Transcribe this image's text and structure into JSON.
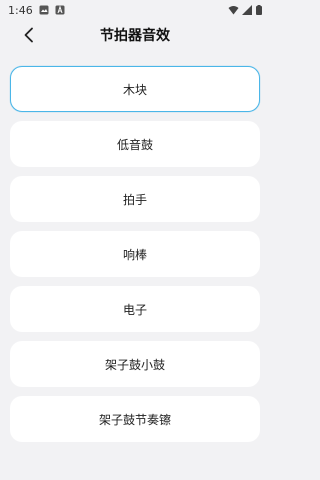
{
  "status_bar": {
    "time": "1:46",
    "left_icons": [
      "gallery-icon",
      "app-a-icon"
    ],
    "right_icons": [
      "wifi-icon",
      "signal-icon",
      "battery-icon"
    ]
  },
  "header": {
    "title": "节拍器音效",
    "back_icon": "chevron-left-icon"
  },
  "sounds": [
    {
      "label": "木块",
      "selected": true
    },
    {
      "label": "低音鼓",
      "selected": false
    },
    {
      "label": "拍手",
      "selected": false
    },
    {
      "label": "响棒",
      "selected": false
    },
    {
      "label": "电子",
      "selected": false
    },
    {
      "label": "架子鼓小鼓",
      "selected": false
    },
    {
      "label": "架子鼓节奏镲",
      "selected": false
    }
  ],
  "colors": {
    "background": "#f2f2f4",
    "card": "#ffffff",
    "selected_border": "#4bb6e8"
  }
}
